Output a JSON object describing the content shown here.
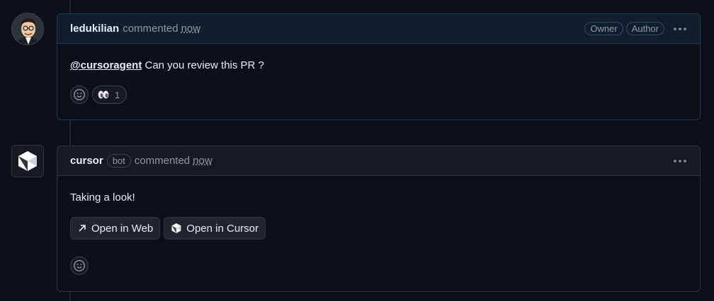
{
  "comments": [
    {
      "author": "ledukilian",
      "action": "commented",
      "time": "now",
      "labels": [
        "Owner",
        "Author"
      ],
      "mention": "@cursoragent",
      "text": " Can you review this PR ?",
      "reaction": {
        "emoji": "eyes",
        "count": "1"
      }
    },
    {
      "author": "cursor",
      "badge": "bot",
      "action": "commented",
      "time": "now",
      "text": "Taking a look!",
      "actions": [
        "Open in Web",
        "Open in Cursor"
      ]
    }
  ],
  "colors": {
    "background": "#0d1117",
    "border": "#30363d",
    "highlight_border": "#1f3a5c"
  }
}
